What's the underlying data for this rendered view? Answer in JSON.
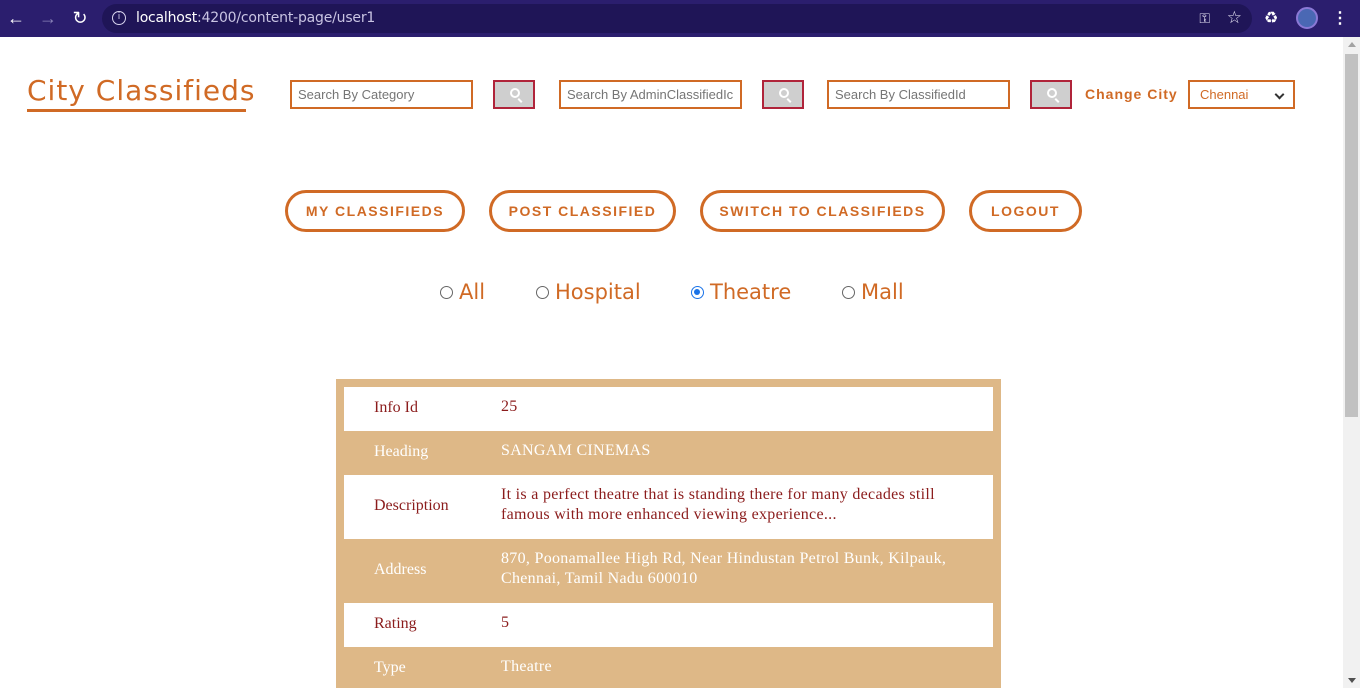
{
  "browser": {
    "url_host": "localhost",
    "url_path": ":4200/content-page/user1"
  },
  "header": {
    "brand": "City Classifieds",
    "search_category_placeholder": "Search By Category",
    "search_admin_placeholder": "Search By AdminClassifiedIc",
    "search_classified_placeholder": "Search By ClassifiedId",
    "change_city_label": "Change City",
    "city_selected": "Chennai"
  },
  "actions": {
    "my_classifieds": "MY CLASSIFIEDS",
    "post_classified": "POST CLASSIFIED",
    "switch_to_classifieds": "SWITCH TO CLASSIFIEDS",
    "logout": "LOGOUT"
  },
  "filters": {
    "options": [
      "All",
      "Hospital",
      "Theatre",
      "Mall"
    ],
    "selected": "Theatre"
  },
  "details": {
    "rows": [
      {
        "label": "Info Id",
        "value": "25"
      },
      {
        "label": "Heading",
        "value": "SANGAM CINEMAS"
      },
      {
        "label": "Description",
        "value": "It is a perfect theatre that is standing there for many decades still famous with more enhanced viewing experience..."
      },
      {
        "label": "Address",
        "value": "870, Poonamallee High Rd, Near Hindustan Petrol Bunk, Kilpauk, Chennai, Tamil Nadu 600010"
      },
      {
        "label": "Rating",
        "value": "5"
      },
      {
        "label": "Type",
        "value": "Theatre"
      }
    ]
  },
  "colors": {
    "accent": "#d06a25",
    "table_tan": "#deb887",
    "text_maroon": "#8b1c1c",
    "chrome": "#2b1e6e"
  }
}
